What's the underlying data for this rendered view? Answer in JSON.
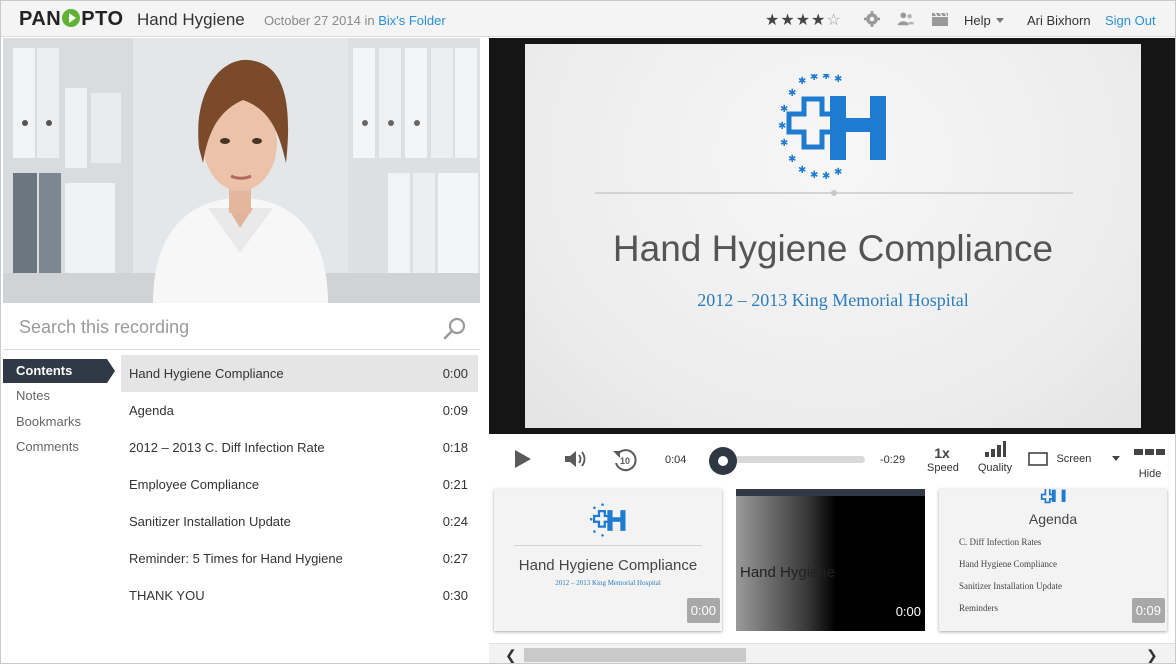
{
  "header": {
    "logo_text_1": "PAN",
    "logo_text_2": "PTO",
    "title": "Hand Hygiene",
    "date": "October 27 2014",
    "in_word": " in ",
    "folder": "Bix's Folder",
    "stars_filled": "★★★★",
    "stars_empty": "☆",
    "rating": 4,
    "help_label": "Help",
    "user_name": "Ari Bixhorn",
    "signout_label": "Sign Out"
  },
  "search": {
    "placeholder": "Search this recording"
  },
  "nav": {
    "items": [
      {
        "label": "Contents",
        "active": true
      },
      {
        "label": "Notes"
      },
      {
        "label": "Bookmarks"
      },
      {
        "label": "Comments"
      }
    ]
  },
  "contents": {
    "rows": [
      {
        "title": "Hand Hygiene Compliance",
        "time": "0:00"
      },
      {
        "title": "Agenda",
        "time": "0:09"
      },
      {
        "title": "2012 – 2013 C. Diff Infection Rate",
        "time": "0:18"
      },
      {
        "title": "Employee Compliance",
        "time": "0:21"
      },
      {
        "title": "Sanitizer Installation Update",
        "time": "0:24"
      },
      {
        "title": "Reminder: 5 Times for Hand Hygiene",
        "time": "0:27"
      },
      {
        "title": "THANK YOU",
        "time": "0:30"
      }
    ]
  },
  "slide": {
    "title": "Hand Hygiene Compliance",
    "subtitle": "2012 – 2013 King Memorial Hospital"
  },
  "player": {
    "elapsed": "0:04",
    "remaining": "-0:29",
    "progress_fraction": 0.05,
    "speed_value": "1x",
    "speed_label": "Speed",
    "quality_label": "Quality",
    "screen_label": "Screen",
    "hide_label": "Hide",
    "rewind_seconds": "10"
  },
  "thumbnails": [
    {
      "title": "Hand Hygiene Compliance",
      "subtitle": "2012 – 2013 King Memorial Hospital",
      "time": "0:00"
    },
    {
      "title": "Hand Hygiene",
      "time": "0:00"
    },
    {
      "title": "Agenda",
      "bullets": [
        "C. Diff Infection Rates",
        "Hand Hygiene Compliance",
        "Sanitizer Installation Update",
        "Reminders"
      ],
      "time": "0:09"
    }
  ],
  "colors": {
    "brand_green": "#5fb233",
    "link_blue": "#2b8fd6",
    "logo_blue": "#1f7bd0",
    "nav_active": "#2f3a46"
  }
}
